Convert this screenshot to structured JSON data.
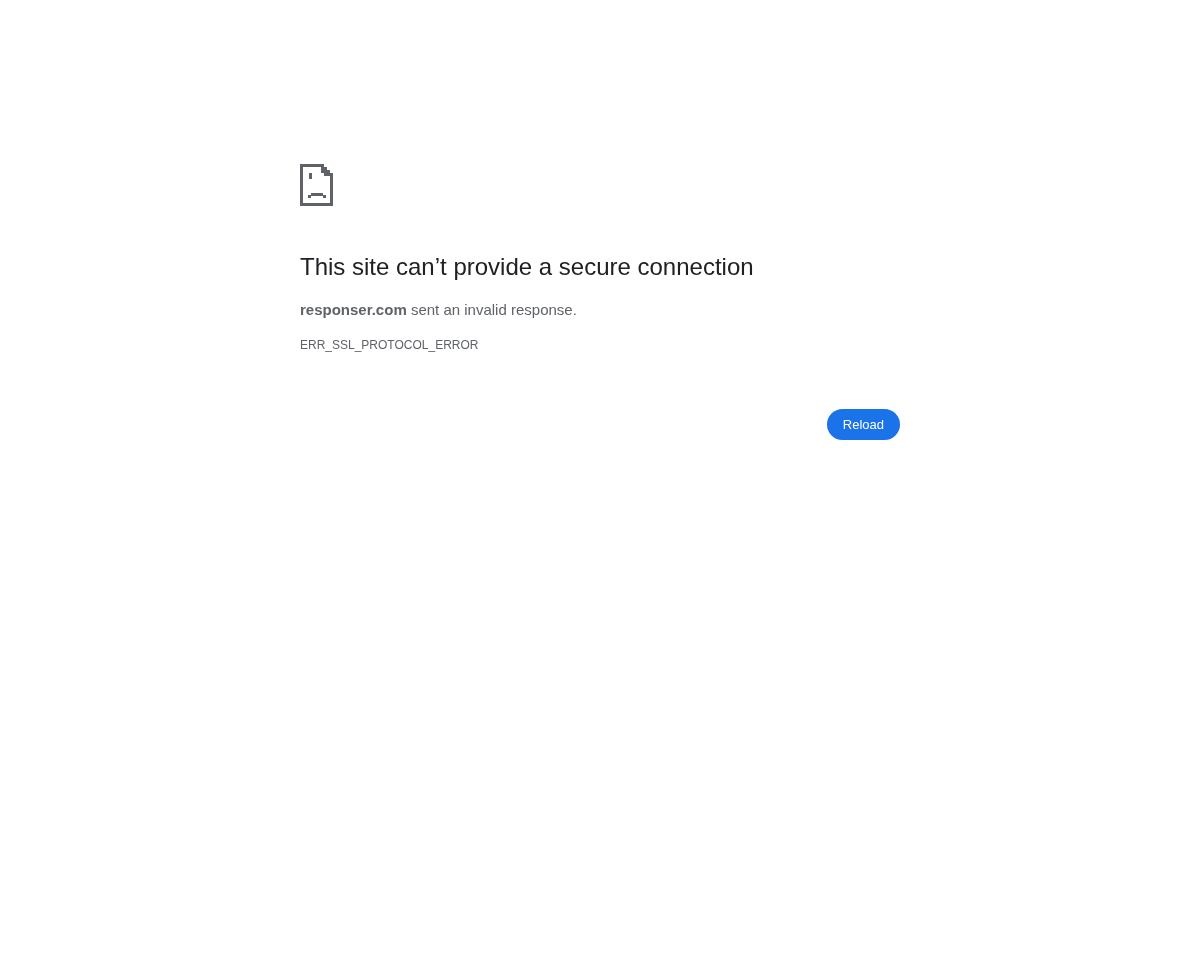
{
  "heading": "This site can’t provide a secure connection",
  "summary": "**responser.com** sent an invalid response.",
  "error_code": "ERR_SSL_PROTOCOL_ERROR",
  "buttons": [
    {
      "label": "Reload"
    }
  ]
}
